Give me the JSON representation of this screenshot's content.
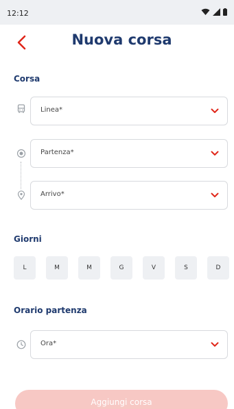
{
  "status_bar": {
    "time": "12:12"
  },
  "header": {
    "title": "Nuova corsa"
  },
  "sections": {
    "corsa": "Corsa",
    "giorni": "Giorni",
    "orario": "Orario partenza"
  },
  "fields": {
    "linea": "Linea*",
    "partenza": "Partenza*",
    "arrivo": "Arrivo*",
    "ora": "Ora*"
  },
  "days": [
    "L",
    "M",
    "M",
    "G",
    "V",
    "S",
    "D"
  ],
  "actions": {
    "add_label": "Aggiungi corsa"
  },
  "colors": {
    "accent": "#e0261a",
    "title": "#1f3a6e",
    "button_disabled": "#f7c8c4",
    "chip_bg": "#eef0f3"
  }
}
